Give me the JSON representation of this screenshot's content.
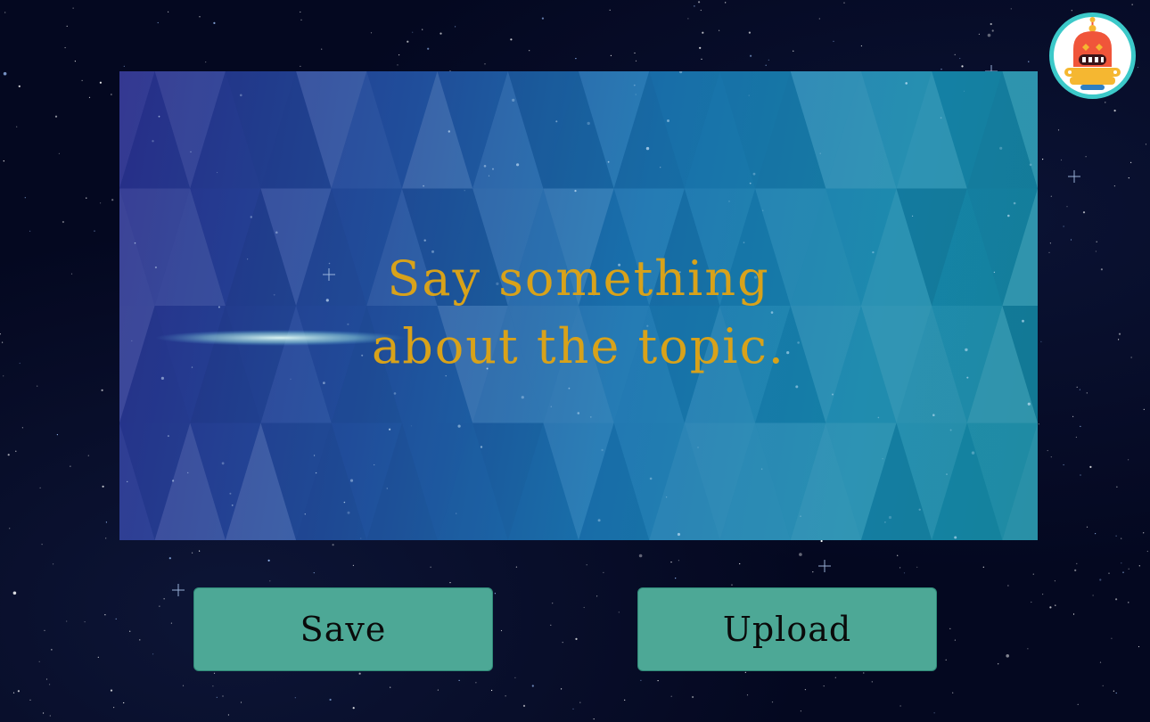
{
  "prompt": {
    "line1": "Say something",
    "line2": "about the topic."
  },
  "buttons": {
    "save_label": "Save",
    "upload_label": "Upload"
  },
  "avatar": {
    "icon": "robot-icon"
  },
  "colors": {
    "prompt_text": "#d8a21a",
    "button_bg": "#4da896",
    "avatar_ring": "#3cc9c9",
    "robot_body": "#f0553a",
    "robot_base": "#f5b731"
  }
}
